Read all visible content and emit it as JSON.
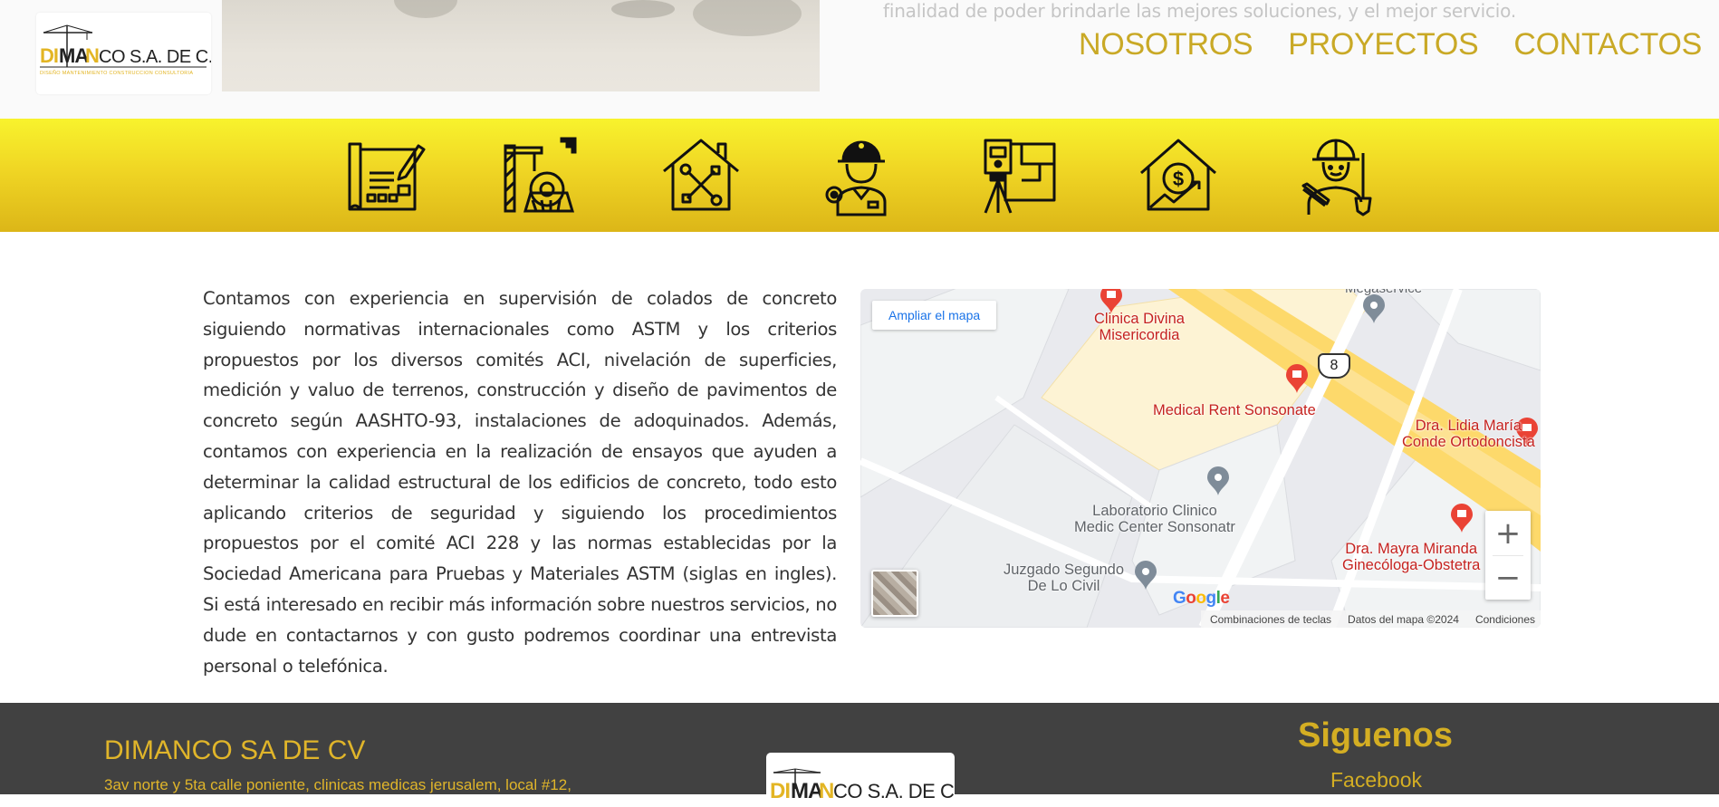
{
  "brand": {
    "logo_text": "DIMANCO S.A. DE C.V.",
    "logo_tagline": "DISEÑO  MANTENIMIENTO  CONSTRUCCION  CONSULTORIA",
    "colors": {
      "accent": "#c9a926",
      "band_top": "#f8f32d",
      "band_bottom": "#dcb618",
      "footer_bg": "#414141"
    }
  },
  "header": {
    "intro_fragment": "finalidad de poder brindarle las mejores soluciones, y el mejor servicio.",
    "nav": [
      {
        "label": "NOSOTROS"
      },
      {
        "label": "PROYECTOS"
      },
      {
        "label": "CONTACTOS"
      }
    ]
  },
  "services_band": {
    "icons": [
      "blueprint-plan-icon",
      "tower-crane-gear-icon",
      "house-tools-icon",
      "construction-worker-icon",
      "surveying-theodolite-icon",
      "house-dollar-growth-icon",
      "engineer-shovel-icon"
    ]
  },
  "about": {
    "text": "Contamos con experiencia en supervisión de colados de concreto siguiendo normativas internacionales como ASTM y los criterios propuestos por los diversos comités ACI, nivelación de superficies, medición y valuo de terrenos, construcción y diseño de pavimentos de concreto según AASHTO-93, instalaciones de adoquinados. Además, contamos con experiencia en la realización de ensayos que ayuden a determinar la calidad estructural de los edificios de concreto, todo esto aplicando criterios de seguridad y siguiendo los procedimientos propuestos por el comité ACI 228 y las normas establecidas por la Sociedad Americana para  Pruebas y  Materiales ASTM (siglas en ingles). Si está interesado en recibir más información sobre nuestros servicios, no dude en contactarnos y con gusto podremos coordinar una entrevista personal o telefónica."
  },
  "map": {
    "enlarge_label": "Ampliar el mapa",
    "places": {
      "clinica_divina": "Clinica Divina\nMisericordia",
      "megaservice": "Megaservice",
      "route_number": "8",
      "medical_rent": "Medical Rent Sonsonate",
      "lidia_maria": "Dra. Lidia María\nConde Ortodoncista",
      "laboratorio": "Laboratorio Clinico\nMedic Center Sonsonatr",
      "mayra_miranda": "Dra. Mayra Miranda\nGinecóloga-Obstetra",
      "juzgado": "Juzgado Segundo\nDe Lo Civil"
    },
    "zoom_in": "+",
    "zoom_out": "−",
    "google_logo": "Google",
    "footer": {
      "shortcuts": "Combinaciones de teclas",
      "data": "Datos del mapa ©2024",
      "terms": "Condiciones"
    }
  },
  "footer": {
    "company": "DIMANCO SA DE CV",
    "address": "3av norte y 5ta calle poniente, clinicas medicas jerusalem, local #12,",
    "follow_title": "Siguenos",
    "facebook": "Facebook"
  }
}
